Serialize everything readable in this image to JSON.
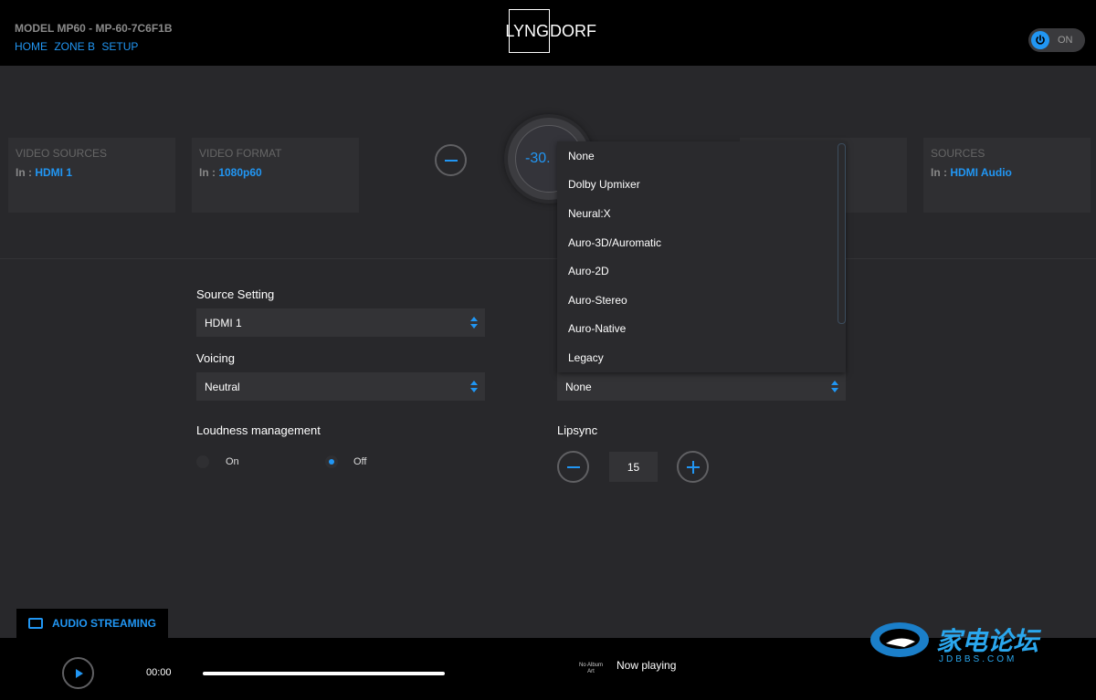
{
  "header": {
    "model": "MODEL MP60 - MP-60-7C6F1B",
    "nav": [
      "HOME",
      "ZONE B",
      "SETUP"
    ],
    "logo_boxed": "LYNG",
    "logo_rest": "DORF",
    "power_label": "ON"
  },
  "cards": [
    {
      "title": "VIDEO SOURCES",
      "prefix": "In : ",
      "value": "HDMI 1"
    },
    {
      "title": "VIDEO FORMAT",
      "prefix": "In : ",
      "value": "1080p60"
    },
    {
      "title": "SOURCES",
      "prefix": "In : ",
      "value": "HDMI Audio"
    }
  ],
  "volume": "-30.",
  "form": {
    "source_setting_label": "Source Setting",
    "source_setting_value": "HDMI 1",
    "voicing_label": "Voicing",
    "voicing_value": "Neutral",
    "upmix_value": "None",
    "loudness_label": "Loudness management",
    "loudness_on": "On",
    "loudness_off": "Off",
    "loudness_selected": "Off",
    "lipsync_label": "Lipsync",
    "lipsync_value": "15"
  },
  "dropdown_options": [
    "None",
    "Dolby Upmixer",
    "Neural:X",
    "Auro-3D/Auromatic",
    "Auro-2D",
    "Auro-Stereo",
    "Auro-Native",
    "Legacy"
  ],
  "footer": {
    "tab_label": "AUDIO STREAMING",
    "time": "00:00",
    "no_album_art": "No Album Art",
    "now_playing": "Now playing"
  },
  "watermark": {
    "text": "家电论坛",
    "sub": "JDBBS.COM"
  },
  "colors": {
    "accent": "#2196f3",
    "background": "#28282b",
    "header": "#000000"
  }
}
